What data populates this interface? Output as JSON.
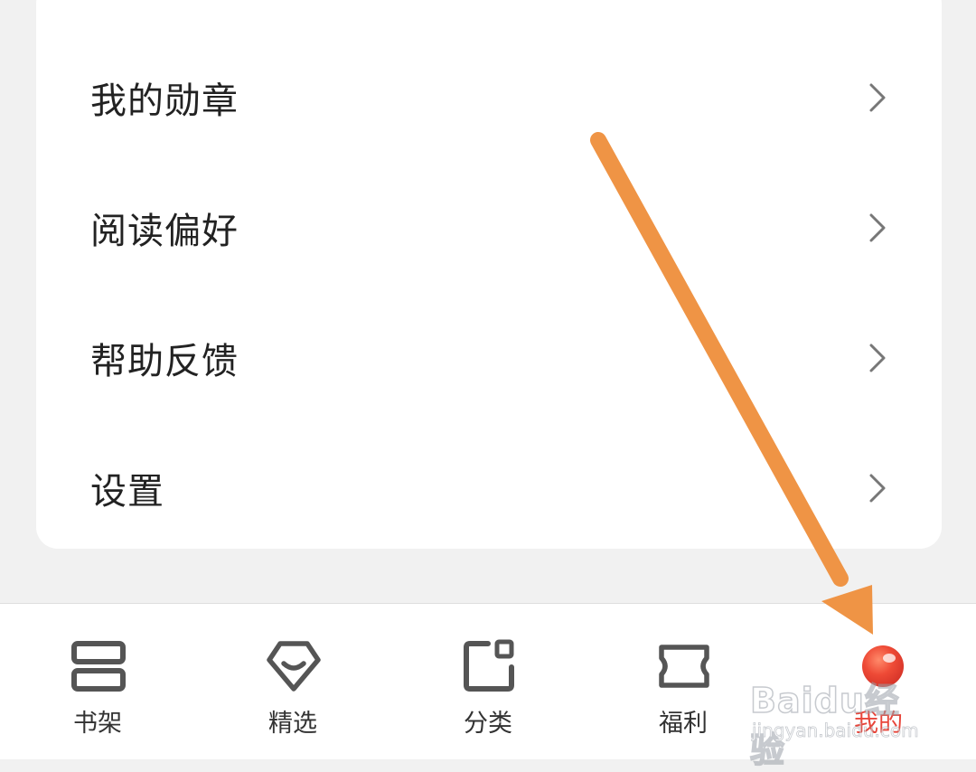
{
  "menu": {
    "items": [
      {
        "label": "我的勋章"
      },
      {
        "label": "阅读偏好"
      },
      {
        "label": "帮助反馈"
      },
      {
        "label": "设置"
      }
    ]
  },
  "tabbar": {
    "tabs": [
      {
        "label": "书架",
        "icon": "bookshelf-icon"
      },
      {
        "label": "精选",
        "icon": "featured-diamond-icon"
      },
      {
        "label": "分类",
        "icon": "category-icon"
      },
      {
        "label": "福利",
        "icon": "welfare-ticket-icon"
      },
      {
        "label": "我的",
        "icon": "profile-avatar-icon"
      }
    ],
    "active_index": 4
  },
  "colors": {
    "accent": "#e8453a",
    "annotation_arrow": "#ef9445",
    "background": "#f1f1f1",
    "card": "#ffffff",
    "text": "#222222",
    "chevron": "#777777"
  },
  "watermark": {
    "brand": "Baidu经验",
    "url": "jingyan.baidu.com"
  }
}
